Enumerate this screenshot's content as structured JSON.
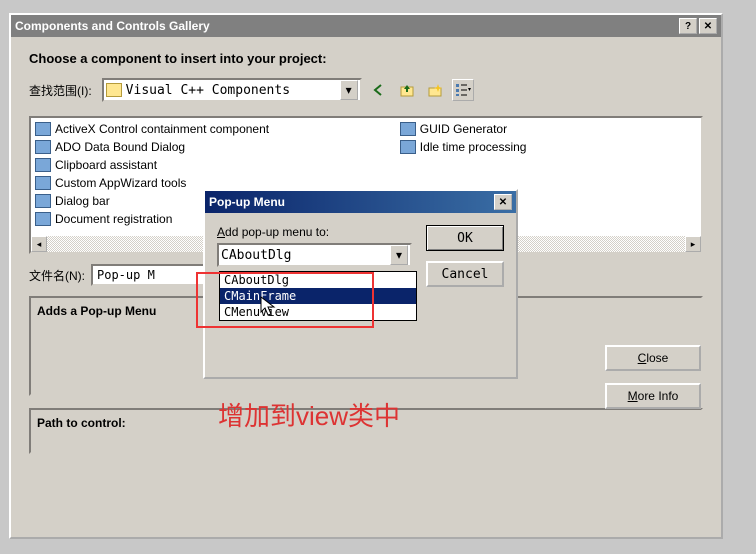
{
  "main": {
    "title": "Components and Controls Gallery",
    "prompt": "Choose a component to insert into your project:",
    "lookin_label": "查找范围(I):",
    "lookin_value": "Visual C++ Components",
    "list_col1": [
      "ActiveX Control containment component",
      "ADO Data Bound Dialog",
      "Clipboard assistant",
      "Custom AppWizard tools",
      "Dialog bar",
      "Document registration"
    ],
    "list_col2": [
      "GUID Generator",
      "Idle time processing"
    ],
    "filename_label": "文件名(N):",
    "filename_value": "Pop-up M",
    "description": "Adds a Pop-up Menu",
    "path_label": "Path to control:",
    "close_label": "Close",
    "moreinfo_label": "More Info"
  },
  "popup": {
    "title": "Pop-up Menu",
    "add_label": "Add pop-up menu to:",
    "selected": "CAboutDlg",
    "options": [
      "CAboutDlg",
      "CMainFrame",
      "CMenuView"
    ],
    "ok_label": "OK",
    "cancel_label": "Cancel"
  },
  "annotation": "增加到view类中"
}
